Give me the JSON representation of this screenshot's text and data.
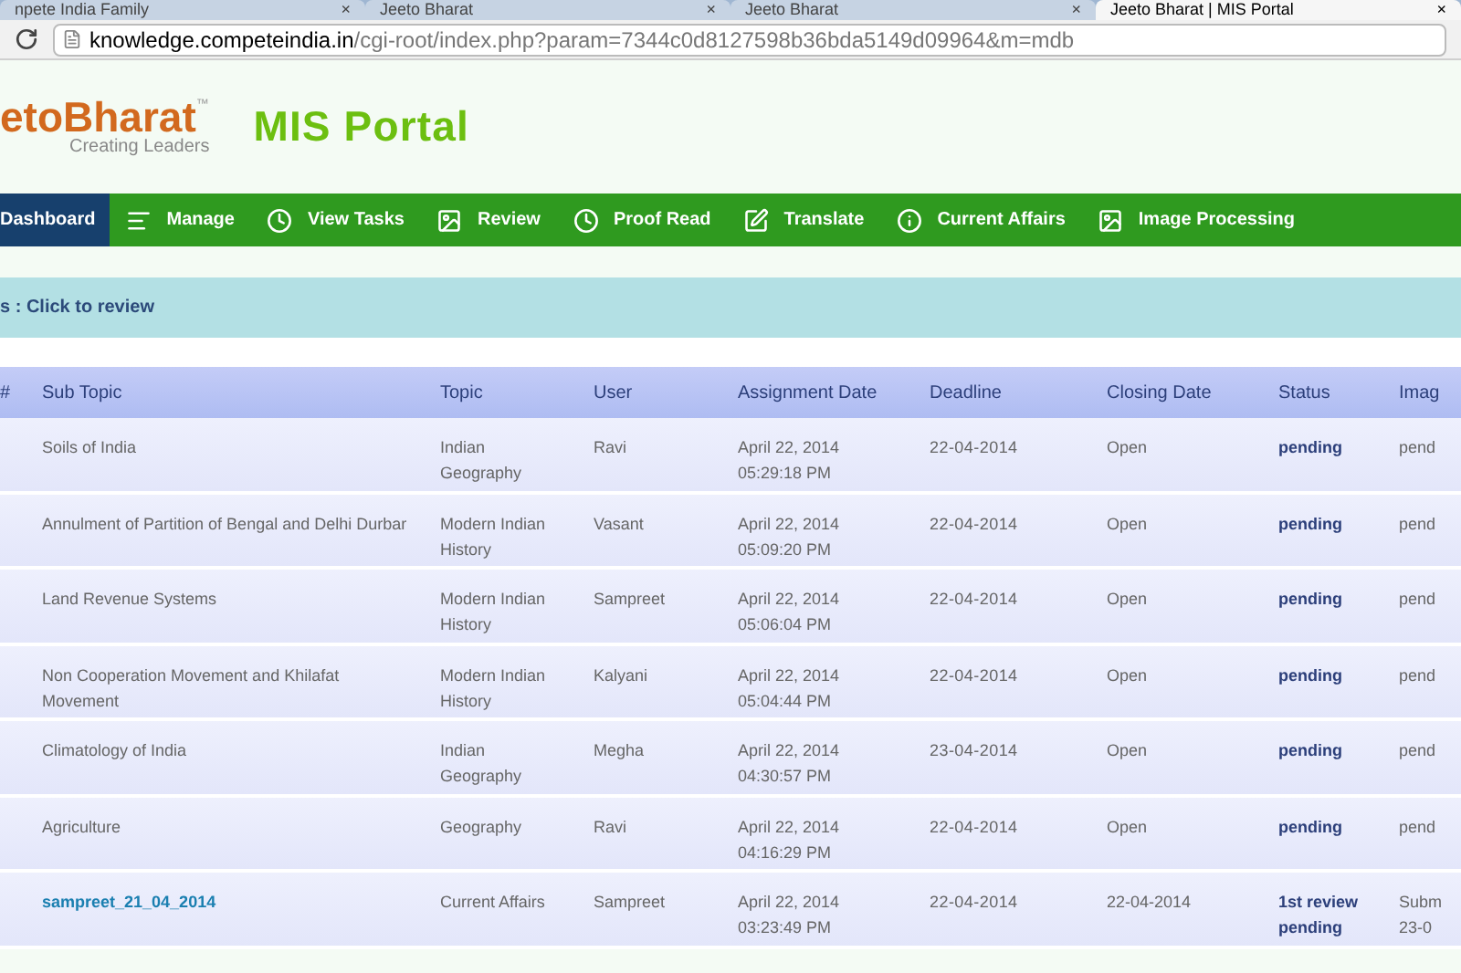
{
  "browser": {
    "tabs": [
      {
        "label": "npete India Family",
        "selected": false
      },
      {
        "label": "Jeeto Bharat",
        "selected": false
      },
      {
        "label": "Jeeto Bharat",
        "selected": false
      },
      {
        "label": "Jeeto Bharat | MIS Portal",
        "selected": true
      }
    ],
    "tab_close": "×",
    "url_host": "knowledge.competeindia.in",
    "url_path": "/cgi-root/index.php?param=7344c0d8127598b36bda5149d09964&m=mdb"
  },
  "header": {
    "logo": "etoBharat",
    "trademark": "™",
    "tagline": "Creating Leaders",
    "portal_title": "MIS Portal"
  },
  "nav": [
    {
      "label": "Dashboard",
      "selected": true
    },
    {
      "label": "Manage",
      "selected": false
    },
    {
      "label": "View Tasks",
      "selected": false
    },
    {
      "label": "Review",
      "selected": false
    },
    {
      "label": "Proof Read",
      "selected": false
    },
    {
      "label": "Translate",
      "selected": false
    },
    {
      "label": "Current Affairs",
      "selected": false
    },
    {
      "label": "Image Processing",
      "selected": false
    }
  ],
  "banner": "s : Click to review",
  "table": {
    "columns": [
      "#",
      "Sub Topic",
      "Topic",
      "User",
      "Assignment Date",
      "Deadline",
      "Closing Date",
      "Status",
      "Imag"
    ],
    "rows": [
      {
        "sub_topic": "Soils of India",
        "kind": "text",
        "topic": "Indian Geography",
        "user": "Ravi",
        "assignment_date": "April 22, 2014 05:29:18 PM",
        "deadline": "22-04-2014",
        "closing_date": "Open",
        "status": "pending",
        "column_9": "pend"
      },
      {
        "sub_topic": "Annulment of Partition of Bengal and Delhi Durbar",
        "kind": "text",
        "topic": "Modern Indian History",
        "user": "Vasant",
        "assignment_date": "April 22, 2014 05:09:20 PM",
        "deadline": "22-04-2014",
        "closing_date": "Open",
        "status": "pending",
        "column_9": "pend"
      },
      {
        "sub_topic": "Land Revenue Systems",
        "kind": "text",
        "topic": "Modern Indian History",
        "user": "Sampreet",
        "assignment_date": "April 22, 2014 05:06:04 PM",
        "deadline": "22-04-2014",
        "closing_date": "Open",
        "status": "pending",
        "column_9": "pend"
      },
      {
        "sub_topic": "Non Cooperation Movement and Khilafat Movement",
        "kind": "text",
        "topic": "Modern Indian History",
        "user": "Kalyani",
        "assignment_date": "April 22, 2014 05:04:44 PM",
        "deadline": "22-04-2014",
        "closing_date": "Open",
        "status": "pending",
        "column_9": "pend"
      },
      {
        "sub_topic": "Climatology of India",
        "kind": "text",
        "topic": "Indian Geography",
        "user": "Megha",
        "assignment_date": "April 22, 2014 04:30:57 PM",
        "deadline": "23-04-2014",
        "closing_date": "Open",
        "status": "pending",
        "column_9": "pend"
      },
      {
        "sub_topic": "Agriculture",
        "kind": "text",
        "topic": "Geography",
        "user": "Ravi",
        "assignment_date": "April 22, 2014 04:16:29 PM",
        "deadline": "22-04-2014",
        "closing_date": "Open",
        "status": "pending",
        "column_9": "pend"
      },
      {
        "sub_topic": "sampreet_21_04_2014",
        "kind": "link",
        "topic": "Current Affairs",
        "user": "Sampreet",
        "assignment_date": "April 22, 2014 03:23:49 PM",
        "deadline": "22-04-2014",
        "closing_date": "22-04-2014",
        "status": "1st review pending",
        "column_9": "Subm 23-0"
      }
    ]
  }
}
